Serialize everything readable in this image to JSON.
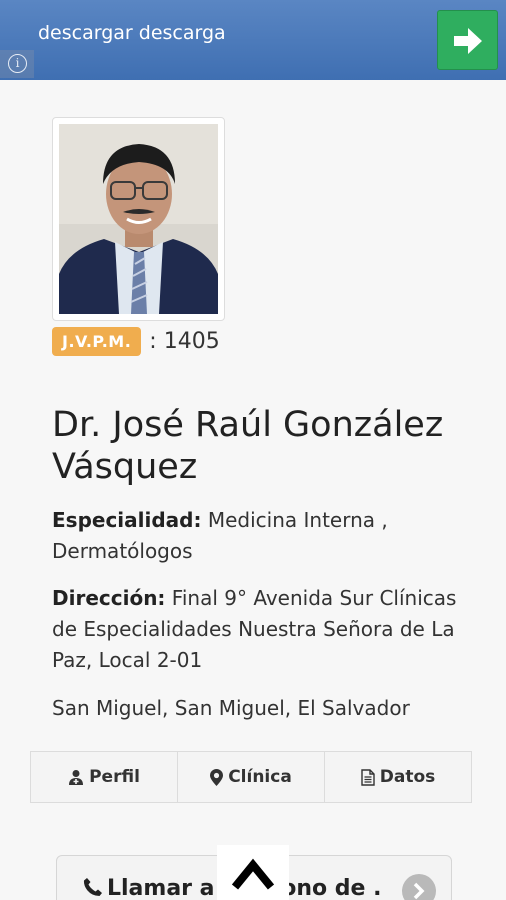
{
  "ad": {
    "text": "descargar descarga",
    "info_glyph": "i",
    "info_icon": "info-icon",
    "go_icon": "arrow-right-icon",
    "go_color": "#2fae5f"
  },
  "doctor": {
    "license_label": "J.V.P.M.",
    "license_number": ": 1405",
    "name": "Dr. José Raúl González Vásquez",
    "specialty_label": "Especialidad:",
    "specialty_value": " Medicina Interna , Dermatólogos",
    "address_label": "Dirección:",
    "address_value": " Final 9° Avenida Sur Clínicas de Especialidades Nuestra Señora de La Paz, Local 2-01",
    "city": "San Miguel, San Miguel, El Salvador"
  },
  "tabs": [
    {
      "label": "Perfil",
      "icon": "user-md-icon"
    },
    {
      "label": "Clínica",
      "icon": "map-marker-icon"
    },
    {
      "label": "Datos",
      "icon": "file-icon"
    }
  ],
  "call": {
    "label": "Llamar a Teléfono de ...",
    "icon": "phone-icon",
    "chevron_icon": "chevron-right-icon"
  },
  "scroll_top_icon": "chevron-up-icon",
  "colors": {
    "accent_badge": "#f0ad4e",
    "banner": "#4a78b8"
  }
}
